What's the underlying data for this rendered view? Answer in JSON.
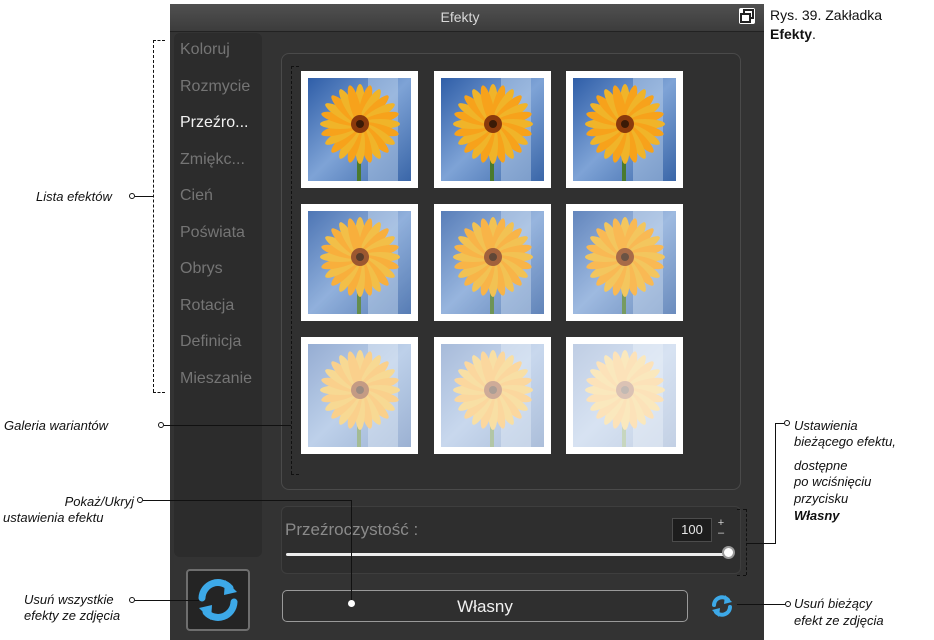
{
  "window": {
    "title": "Efekty",
    "restore_icon": "restore-window-icon"
  },
  "caption": {
    "prefix": "Rys. 39. Zakładka",
    "bold": "Efekty",
    "suffix": "."
  },
  "effects": [
    {
      "label": "Koloruj",
      "active": false
    },
    {
      "label": "Rozmycie",
      "active": false
    },
    {
      "label": "Przeźro...",
      "active": true
    },
    {
      "label": "Zmiękc...",
      "active": false
    },
    {
      "label": "Cień",
      "active": false
    },
    {
      "label": "Poświata",
      "active": false
    },
    {
      "label": "Obrys",
      "active": false
    },
    {
      "label": "Rotacja",
      "active": false
    },
    {
      "label": "Definicja",
      "active": false
    },
    {
      "label": "Mieszanie",
      "active": false
    }
  ],
  "gallery": {
    "variant_opacity": [
      1.0,
      1.0,
      1.0,
      0.85,
      0.8,
      0.75,
      0.5,
      0.42,
      0.3
    ]
  },
  "settings": {
    "label": "Przeźroczystość :",
    "value": "100",
    "slider_fraction": 1.0
  },
  "buttons": {
    "wlasny": "Własny",
    "remove_all_icon": "refresh-icon",
    "remove_current_icon": "refresh-icon"
  },
  "annotations": {
    "lista": "Lista efektów",
    "galeria": "Galeria wariantów",
    "pokaz_1": "Pokaż/Ukryj",
    "pokaz_2": "ustawienia efektu",
    "usun_all_1": "Usuń wszystkie",
    "usun_all_2": "efekty ze zdjęcia",
    "ustawienia_1": "Ustawienia",
    "ustawienia_2": "bieżącego efektu,",
    "ustawienia_3": "dostępne",
    "ustawienia_4": "po wciśnięciu",
    "ustawienia_5": "przycisku",
    "ustawienia_6": "Własny",
    "usun_cur_1": "Usuń bieżący",
    "usun_cur_2": "efekt ze zdjęcia"
  },
  "colors": {
    "panel": "#333333",
    "active_effect": "#f2f2f2",
    "inactive_effect": "#757575",
    "accent_icon": "#3da9e8"
  }
}
